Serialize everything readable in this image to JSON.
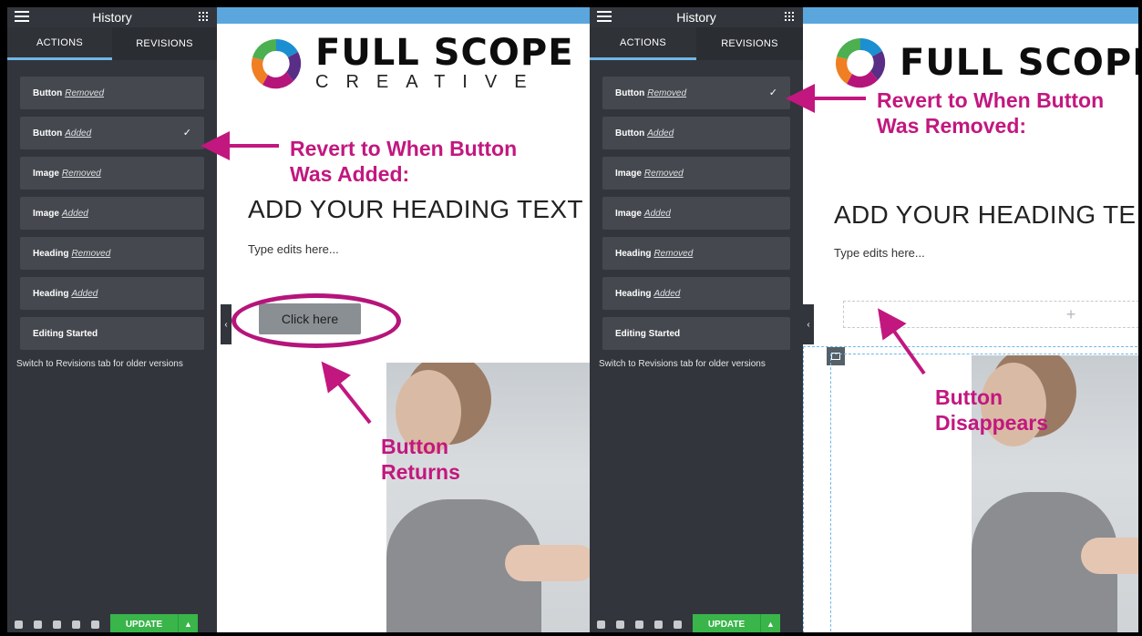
{
  "colors": {
    "panel_bg": "#32363c",
    "item_bg": "#45494f",
    "tab_active_underline": "#71b7e6",
    "annotation": "#c2177f",
    "update_green": "#39b54a",
    "canvas_top_bar": "#5aa6dd"
  },
  "left_panel": {
    "title": "History",
    "tabs": [
      {
        "label": "ACTIONS",
        "active": true
      },
      {
        "label": "REVISIONS",
        "active": false
      }
    ],
    "items": [
      {
        "type": "Button",
        "action": "Removed",
        "checked": false
      },
      {
        "type": "Button",
        "action": "Added",
        "checked": true
      },
      {
        "type": "Image",
        "action": "Removed",
        "checked": false
      },
      {
        "type": "Image",
        "action": "Added",
        "checked": false
      },
      {
        "type": "Heading",
        "action": "Removed",
        "checked": false
      },
      {
        "type": "Heading",
        "action": "Added",
        "checked": false
      },
      {
        "type": "Editing Started",
        "action": "",
        "checked": false
      }
    ],
    "hint": "Switch to Revisions tab for older versions",
    "update_label": "UPDATE",
    "check_glyph": "✓"
  },
  "right_panel": {
    "title": "History",
    "tabs": [
      {
        "label": "ACTIONS",
        "active": true
      },
      {
        "label": "REVISIONS",
        "active": false
      }
    ],
    "items": [
      {
        "type": "Button",
        "action": "Removed",
        "checked": true
      },
      {
        "type": "Button",
        "action": "Added",
        "checked": false
      },
      {
        "type": "Image",
        "action": "Removed",
        "checked": false
      },
      {
        "type": "Image",
        "action": "Added",
        "checked": false
      },
      {
        "type": "Heading",
        "action": "Removed",
        "checked": false
      },
      {
        "type": "Heading",
        "action": "Added",
        "checked": false
      },
      {
        "type": "Editing Started",
        "action": "",
        "checked": false
      }
    ],
    "hint": "Switch to Revisions tab for older versions",
    "update_label": "UPDATE",
    "check_glyph": "✓"
  },
  "canvas_left": {
    "logo_line1": "FULL SCOPE",
    "logo_line2": "CREATIVE",
    "heading": "ADD YOUR HEADING TEXT",
    "subtext": "Type edits here...",
    "button_label": "Click here"
  },
  "canvas_right": {
    "logo_line1": "FULL SCOPE",
    "heading": "ADD YOUR HEADING TE",
    "subtext": "Type edits here...",
    "placeholder_glyph": "+"
  },
  "annotations": {
    "left_arrow_note_l1": "Revert to When Button",
    "left_arrow_note_l2": "Was Added:",
    "button_returns_l1": "Button",
    "button_returns_l2": "Returns",
    "right_arrow_note_l1": "Revert to When Button",
    "right_arrow_note_l2": "Was Removed:",
    "button_disappears_l1": "Button",
    "button_disappears_l2": "Disappears"
  },
  "collapse_glyph": "‹"
}
